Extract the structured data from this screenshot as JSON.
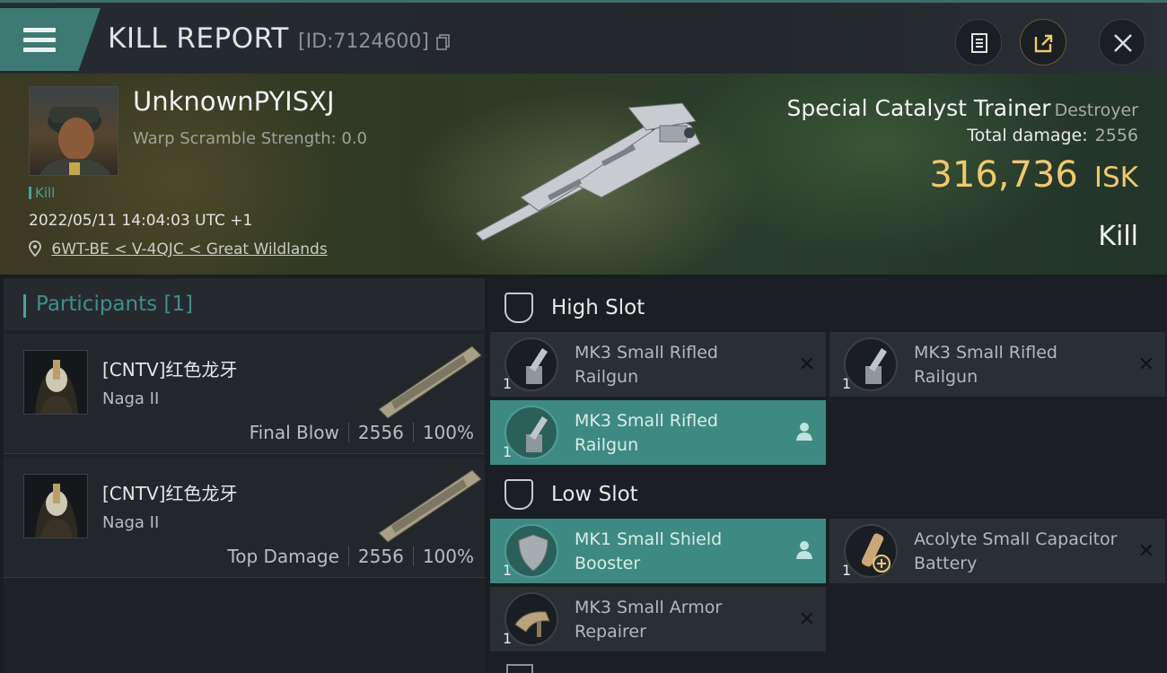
{
  "header": {
    "title": "KILL REPORT",
    "report_id": "[ID:7124600]",
    "icons": [
      "menu-icon",
      "copy-icon",
      "clipboard-icon",
      "share-icon",
      "close-icon"
    ]
  },
  "victim": {
    "name": "UnknownPYISXJ",
    "warp_scramble": "Warp Scramble Strength: 0.0",
    "tag": "Kill",
    "datetime": "2022/05/11 14:04:03 UTC +1",
    "location": "6WT-BE < V-4QJC < Great Wildlands",
    "ship_name": "Special Catalyst Trainer",
    "ship_class": "Destroyer",
    "total_damage_label": "Total damage:",
    "total_damage_value": "2556",
    "isk_value": "316,736",
    "isk_unit": "ISK",
    "result": "Kill"
  },
  "participants": {
    "header": "Participants [1]",
    "rows": [
      {
        "corp_name": "[CNTV]红色龙牙",
        "ship": "Naga II",
        "role": "Final Blow",
        "damage": "2556",
        "percent": "100%"
      },
      {
        "corp_name": "[CNTV]红色龙牙",
        "ship": "Naga II",
        "role": "Top Damage",
        "damage": "2556",
        "percent": "100%"
      }
    ]
  },
  "slots": {
    "high": {
      "label": "High Slot",
      "modules": [
        {
          "name": "MK3 Small Rifled Railgun",
          "qty": "1",
          "active": false
        },
        {
          "name": "MK3 Small Rifled Railgun",
          "qty": "1",
          "active": false
        },
        {
          "name": "MK3 Small Rifled Railgun",
          "qty": "1",
          "active": true
        }
      ]
    },
    "low": {
      "label": "Low Slot",
      "modules": [
        {
          "name": "MK1 Small Shield Booster",
          "qty": "1",
          "active": true
        },
        {
          "name": "Acolyte Small Capacitor Battery",
          "qty": "1",
          "active": false
        },
        {
          "name": "MK3 Small Armor Repairer",
          "qty": "1",
          "active": false
        }
      ]
    }
  },
  "colors": {
    "accent": "#3e8a83",
    "isk": "#f0c86e",
    "header_tab": "#3c7a73"
  }
}
